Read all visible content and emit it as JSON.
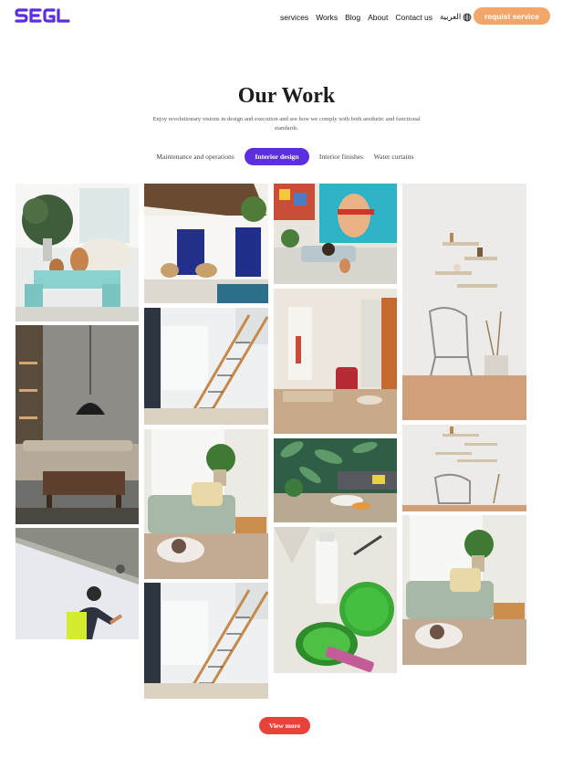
{
  "header": {
    "logo_text": "SEGL",
    "nav": [
      "services",
      "Works",
      "Blog",
      "About",
      "Contact us"
    ],
    "language": "العربية",
    "language_icon": "globe-icon",
    "cta_label": "requist service"
  },
  "section": {
    "title": "Our Work",
    "subtitle": "Enjoy revolutionary visions in design and execution and see how we comply with both aesthetic and functional standards."
  },
  "tabs": [
    {
      "label": "Maintenance and operations",
      "active": false
    },
    {
      "label": "Interior design",
      "active": true
    },
    {
      "label": "Interior finishes",
      "active": false
    },
    {
      "label": "Water curtains",
      "active": false
    }
  ],
  "gallery": {
    "items": [
      "living-room-turquoise-table",
      "dark-lounge-pendant-lamp",
      "ceiling-worker",
      "courtyard-blue-doors",
      "white-staircase",
      "green-sofa-dog",
      "white-staircase",
      "colorful-mural-room",
      "red-armchair-room",
      "leaf-wallpaper-lounge",
      "paint-cans",
      "shelves-white-chair",
      "shelves-white-chair",
      "green-sofa-dog"
    ]
  },
  "footer": {
    "view_more_label": "View more"
  },
  "colors": {
    "brand": "#5b2ee0",
    "cta": "#f3a66a",
    "view_more": "#e8423a"
  }
}
